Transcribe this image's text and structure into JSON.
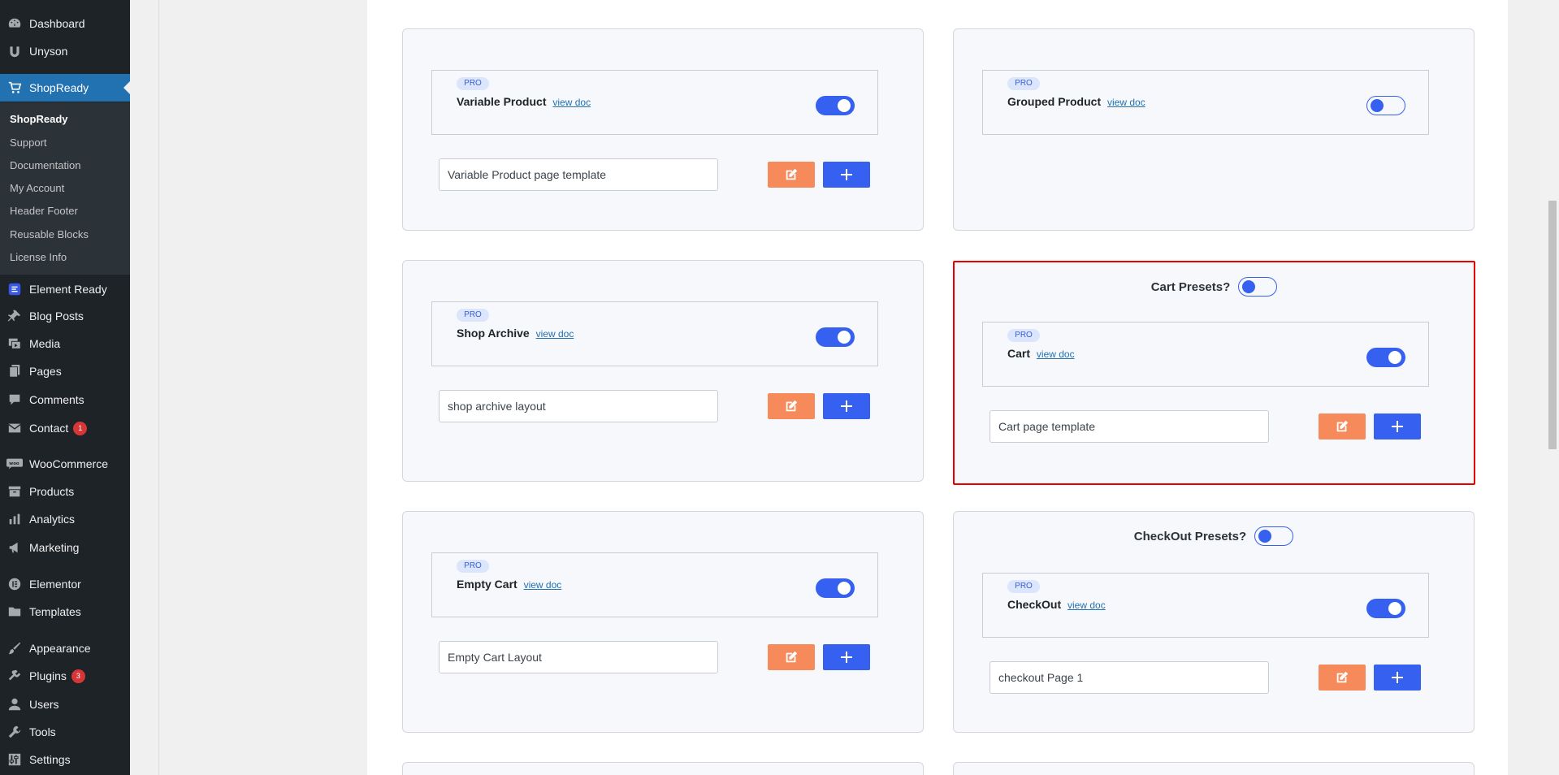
{
  "sidebar": {
    "items": [
      {
        "label": "Dashboard",
        "icon": "dashboard-icon"
      },
      {
        "label": "Unyson",
        "icon": "unyson-icon"
      },
      {
        "label": "ShopReady",
        "icon": "cart-icon",
        "active": true
      },
      {
        "label": "Element Ready",
        "icon": "element-ready-icon"
      },
      {
        "label": "Blog Posts",
        "icon": "pin-icon"
      },
      {
        "label": "Media",
        "icon": "media-icon"
      },
      {
        "label": "Pages",
        "icon": "pages-icon"
      },
      {
        "label": "Comments",
        "icon": "comment-icon"
      },
      {
        "label": "Contact",
        "icon": "mail-icon",
        "badge": "1"
      },
      {
        "label": "WooCommerce",
        "icon": "woo-icon"
      },
      {
        "label": "Products",
        "icon": "archive-icon"
      },
      {
        "label": "Analytics",
        "icon": "bar-chart-icon"
      },
      {
        "label": "Marketing",
        "icon": "megaphone-icon"
      },
      {
        "label": "Elementor",
        "icon": "elementor-icon"
      },
      {
        "label": "Templates",
        "icon": "folder-icon"
      },
      {
        "label": "Appearance",
        "icon": "brush-icon"
      },
      {
        "label": "Plugins",
        "icon": "plugin-icon",
        "badge": "3"
      },
      {
        "label": "Users",
        "icon": "user-icon"
      },
      {
        "label": "Tools",
        "icon": "wrench-icon"
      },
      {
        "label": "Settings",
        "icon": "settings-icon"
      }
    ],
    "submenu": [
      "ShopReady",
      "Support",
      "Documentation",
      "My Account",
      "Header Footer",
      "Reusable Blocks",
      "License Info"
    ]
  },
  "common": {
    "pro_badge": "PRO",
    "view_doc": "view doc"
  },
  "cards": [
    {
      "title": "Variable Product",
      "enabled": true,
      "template": "Variable Product page template"
    },
    {
      "title": "Grouped Product",
      "enabled": false
    },
    {
      "title": "Shop Archive",
      "enabled": true,
      "template": "shop archive layout"
    },
    {
      "preset_label": "Cart Presets?",
      "preset_enabled": false,
      "title": "Cart",
      "enabled": true,
      "template": "Cart page template",
      "highlighted": true
    },
    {
      "title": "Empty Cart",
      "enabled": true,
      "template": "Empty Cart Layout"
    },
    {
      "preset_label": "CheckOut Presets?",
      "preset_enabled": false,
      "title": "CheckOut",
      "enabled": true,
      "template": "checkout Page 1"
    }
  ],
  "colors": {
    "accent_blue": "#3661f0",
    "edit_orange": "#f78a5a",
    "highlight_red": "#e60000",
    "sidebar_bg": "#1d2327",
    "wp_blue": "#2271b1"
  }
}
